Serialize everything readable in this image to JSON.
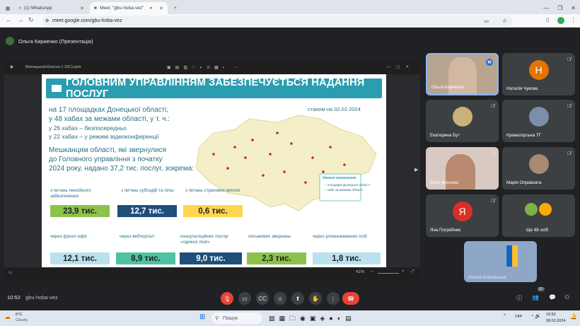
{
  "browser": {
    "tabs": [
      {
        "label": "(1) WhatsApp",
        "active": false
      },
      {
        "label": "Meet: \"gbu-hoba-vez\"",
        "active": true
      }
    ],
    "url": "meet.google.com/gbu-hoba-vez"
  },
  "meet": {
    "presenter": "Ольга Кириенко (Презентація)",
    "meeting_code": "gbu-hoba-vez",
    "time": "10:52",
    "participants_count": "97"
  },
  "ppt": {
    "file_label": "Вінницька(обласна 1-1КС).pptx",
    "zoom": "41%"
  },
  "slide": {
    "title": "ГОЛОВНИМ УПРАВЛІННЯМ ЗАБЕЗПЕЧУЄТЬСЯ НАДАННЯ ПОСЛУГ",
    "date_note": "станом на 02.02.2024",
    "line1": "на 17 площадках Донецької області,",
    "line2": "у 48 хабах за межами області, у т. ч.:",
    "line3": "у 26 хабах – безпосередньо",
    "line4": "у 22 хабах – у режимі відеоконференції",
    "para1": "Мешканцям області, які звернулися",
    "para2": "до Головного управління з початку",
    "para3": "2024 року, надано 37,2 тис. послуг, зокрема:",
    "legend_title": "Умовні позначення",
    "legend_1": "– площадки Донецької області",
    "legend_2": "– хаби за межами області",
    "row1": [
      {
        "label": "з питань пенсійного забезпечення",
        "value": "23,9 тис.",
        "color": "#8bc34a"
      },
      {
        "label": "з питань субсидій та пільг",
        "value": "12,7 тис.",
        "color": "#1e4f7a"
      },
      {
        "label": "з питань страхових виплат",
        "value": "0,6 тис.",
        "color": "#ffd54f"
      }
    ],
    "row2": [
      {
        "label": "через фронт-офіс",
        "value": "12,1 тис.",
        "color": "#b9e2ee"
      },
      {
        "label": "через вебпортал",
        "value": "8,9 тис.",
        "color": "#4fc3a1"
      },
      {
        "label": "консультаційних послуг «гарячої лінії»",
        "value": "9,0 тис.",
        "color": "#1e4f7a"
      },
      {
        "label": "письмових звернень",
        "value": "2,3 тис.",
        "color": "#8bc34a"
      },
      {
        "label": "через уповноважених осіб",
        "value": "1,8 тис.",
        "color": "#b9e2ee"
      }
    ]
  },
  "tiles": [
    {
      "name": "Ольга Кириенко",
      "type": "video",
      "speaking": true
    },
    {
      "name": "Наталія Чукова",
      "type": "avatar",
      "letter": "Н",
      "color": "#e37400"
    },
    {
      "name": "Екатерина Бут",
      "type": "photo"
    },
    {
      "name": "Краматорська ТГ",
      "type": "photo"
    },
    {
      "name": "Юлія Фесенко",
      "type": "video"
    },
    {
      "name": "Марія Оправхата",
      "type": "photo"
    },
    {
      "name": "Яна Погребняк",
      "type": "avatar",
      "letter": "Я",
      "color": "#d93025"
    },
    {
      "name": "Ще 88 осіб",
      "type": "group"
    }
  ],
  "self_tile": {
    "name": "Олена Ковальська"
  },
  "taskbar": {
    "weather_temp": "6°C",
    "weather_desc": "Cloudy",
    "search": "Пошук",
    "lang": "УКР",
    "clock_time": "10:52",
    "clock_date": "08.02.2024"
  }
}
